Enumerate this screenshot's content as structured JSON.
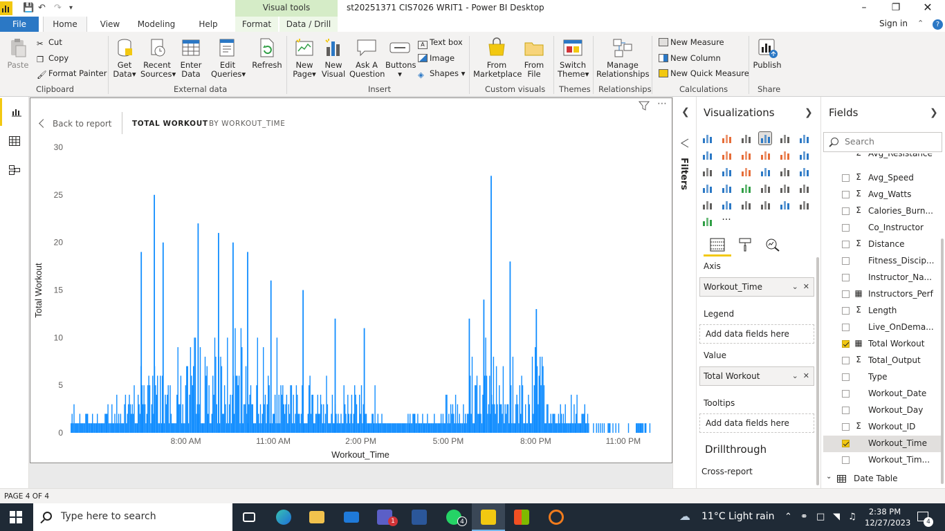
{
  "app": {
    "window_title": "st20251371 CIS7026 WRIT1 - Power BI Desktop",
    "context_tab_group": "Visual tools",
    "sign_in": "Sign in"
  },
  "tabs": [
    "File",
    "Home",
    "View",
    "Modeling",
    "Help",
    "Format",
    "Data / Drill"
  ],
  "ribbon": {
    "clipboard": {
      "label": "Clipboard",
      "paste": "Paste",
      "cut": "Cut",
      "copy": "Copy",
      "format_painter": "Format Painter"
    },
    "external_data": {
      "label": "External data",
      "get_data": [
        "Get",
        "Data"
      ],
      "recent_sources": [
        "Recent",
        "Sources"
      ],
      "enter_data": [
        "Enter",
        "Data"
      ],
      "edit_queries": [
        "Edit",
        "Queries"
      ],
      "refresh": "Refresh"
    },
    "insert": {
      "label": "Insert",
      "new_page": [
        "New",
        "Page"
      ],
      "new_visual": [
        "New",
        "Visual"
      ],
      "ask_question": [
        "Ask A",
        "Question"
      ],
      "buttons": "Buttons",
      "text_box": "Text box",
      "image": "Image",
      "shapes": "Shapes"
    },
    "custom_visuals": {
      "label": "Custom visuals",
      "from_marketplace": [
        "From",
        "Marketplace"
      ],
      "from_file": [
        "From",
        "File"
      ]
    },
    "themes": {
      "label": "Themes",
      "switch_theme": [
        "Switch",
        "Theme"
      ]
    },
    "relationships": {
      "label": "Relationships",
      "manage": [
        "Manage",
        "Relationships"
      ]
    },
    "calculations": {
      "label": "Calculations",
      "new_measure": "New Measure",
      "new_column": "New Column",
      "new_quick_measure": "New Quick Measure"
    },
    "share": {
      "label": "Share",
      "publish": "Publish"
    }
  },
  "focus_mode": {
    "back": "Back to report",
    "tabs": [
      "TOTAL WORKOUT",
      "BY WORKOUT_TIME"
    ]
  },
  "filters_label": "Filters",
  "visualizations": {
    "title": "Visualizations",
    "wells": [
      {
        "label": "Axis",
        "value": "Workout_Time"
      },
      {
        "label": "Legend",
        "placeholder": "Add data fields here"
      },
      {
        "label": "Value",
        "value": "Total Workout"
      },
      {
        "label": "Tooltips",
        "placeholder": "Add data fields here"
      }
    ],
    "drillthrough": "Drillthrough",
    "cross_report": "Cross-report"
  },
  "fields": {
    "title": "Fields",
    "search_placeholder": "Search",
    "items": [
      {
        "name": "Avg_Resistance",
        "type": "sigma",
        "checked": false
      },
      {
        "name": "Avg_Speed",
        "type": "sigma",
        "checked": false
      },
      {
        "name": "Avg_Watts",
        "type": "sigma",
        "checked": false
      },
      {
        "name": "Calories_Burn...",
        "type": "sigma",
        "checked": false
      },
      {
        "name": "Co_Instructor",
        "type": "text",
        "checked": false
      },
      {
        "name": "Distance",
        "type": "sigma",
        "checked": false
      },
      {
        "name": "Fitness_Discip...",
        "type": "text",
        "checked": false
      },
      {
        "name": "Instructor_Na...",
        "type": "text",
        "checked": false
      },
      {
        "name": "Instructors_Perf",
        "type": "measure",
        "checked": false
      },
      {
        "name": "Length",
        "type": "sigma",
        "checked": false
      },
      {
        "name": "Live_OnDema...",
        "type": "text",
        "checked": false
      },
      {
        "name": "Total Workout",
        "type": "measure",
        "checked": true
      },
      {
        "name": "Total_Output",
        "type": "sigma",
        "checked": false
      },
      {
        "name": "Type",
        "type": "text",
        "checked": false
      },
      {
        "name": "Workout_Date",
        "type": "text",
        "checked": false
      },
      {
        "name": "Workout_Day",
        "type": "text",
        "checked": false
      },
      {
        "name": "Workout_ID",
        "type": "sigma",
        "checked": false
      },
      {
        "name": "Workout_Time",
        "type": "text",
        "checked": true,
        "highlighted": true
      },
      {
        "name": "Workout_Tim...",
        "type": "text",
        "checked": false
      }
    ],
    "table": "Date Table"
  },
  "status": {
    "page": "PAGE 4 OF 4"
  },
  "taskbar": {
    "search_placeholder": "Type here to search",
    "weather": "11°C  Light rain",
    "time": "2:38 PM",
    "date": "12/27/2023",
    "teams_badge": "1",
    "whatsapp_badge": "4",
    "notifications": "4"
  },
  "colors": {
    "accent": "#f2c811",
    "bar": "#118dff",
    "file_tab": "#2b78c5",
    "taskbar": "#1f2a36"
  },
  "chart_data": {
    "type": "bar",
    "xlabel": "Workout_Time",
    "ylabel": "Total Workout",
    "ylim": [
      0,
      30
    ],
    "yticks": [
      0,
      5,
      10,
      15,
      20,
      25,
      30
    ],
    "x_tick_labels": [
      "8:00 AM",
      "11:00 AM",
      "2:00 PM",
      "5:00 PM",
      "8:00 PM",
      "11:00 PM"
    ],
    "x_tick_hours": [
      8,
      11,
      14,
      17,
      20,
      23
    ],
    "x_range_hours": [
      4.0,
      24.0
    ],
    "grid": false,
    "legend": "none",
    "peaks": [
      {
        "time_hours": 6.45,
        "value": 19
      },
      {
        "time_hours": 6.9,
        "value": 25
      },
      {
        "time_hours": 7.2,
        "value": 20
      },
      {
        "time_hours": 8.4,
        "value": 22
      },
      {
        "time_hours": 9.1,
        "value": 21
      },
      {
        "time_hours": 9.6,
        "value": 20
      },
      {
        "time_hours": 10.1,
        "value": 19
      },
      {
        "time_hours": 10.9,
        "value": 16
      },
      {
        "time_hours": 12.0,
        "value": 15
      },
      {
        "time_hours": 13.1,
        "value": 12
      },
      {
        "time_hours": 14.1,
        "value": 11
      },
      {
        "time_hours": 17.7,
        "value": 12
      },
      {
        "time_hours": 18.2,
        "value": 14
      },
      {
        "time_hours": 18.45,
        "value": 27
      },
      {
        "time_hours": 19.1,
        "value": 18
      },
      {
        "time_hours": 20.0,
        "value": 13
      }
    ]
  }
}
